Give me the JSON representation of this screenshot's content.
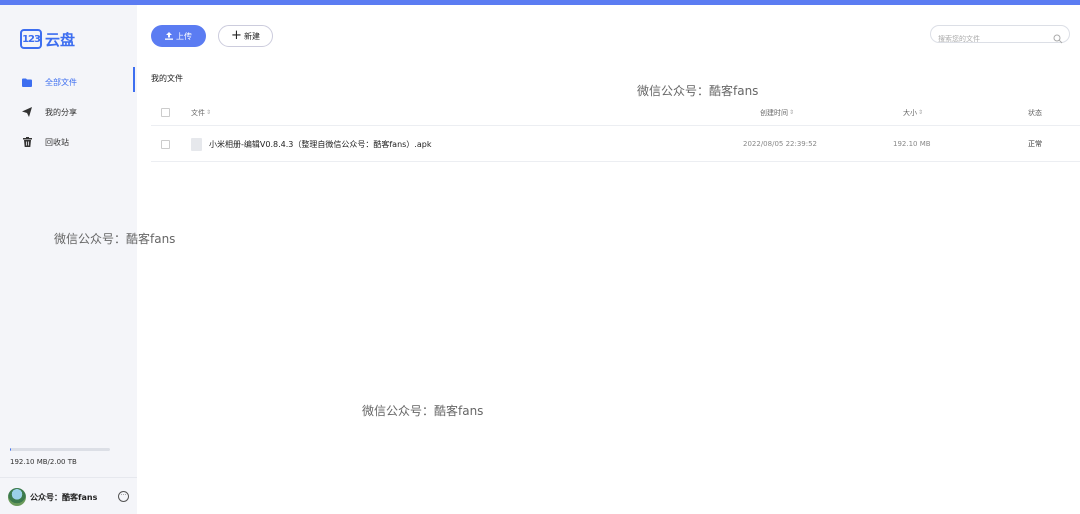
{
  "app": {
    "logo_badge": "123",
    "logo_text": "云盘"
  },
  "sidebar": {
    "items": [
      {
        "label": "全部文件",
        "icon": "folder-icon",
        "active": true
      },
      {
        "label": "我的分享",
        "icon": "share-plane-icon",
        "active": false
      },
      {
        "label": "回收站",
        "icon": "trash-icon",
        "active": false
      }
    ],
    "storage": {
      "text": "192.10 MB/2.00 TB",
      "used_fraction": 0.0001
    },
    "user": {
      "name": "公众号：酷客fans"
    }
  },
  "toolbar": {
    "upload_label": "上传",
    "new_label": "新建"
  },
  "search": {
    "placeholder": "搜索您的文件"
  },
  "breadcrumb": "我的文件",
  "table": {
    "headers": {
      "name": "文件",
      "date": "创建时间",
      "size": "大小",
      "status": "状态"
    },
    "rows": [
      {
        "name": "小米相册-编辑V0.8.4.3（整理自微信公众号：酷客fans）.apk",
        "date": "2022/08/05 22:39:52",
        "size": "192.10 MB",
        "status": "正常"
      }
    ]
  },
  "watermark": "微信公众号：酷客fans",
  "colors": {
    "accent": "#3d6ef0",
    "topbar": "#5b7cf2",
    "sidebar_bg": "#f4f5f9"
  }
}
